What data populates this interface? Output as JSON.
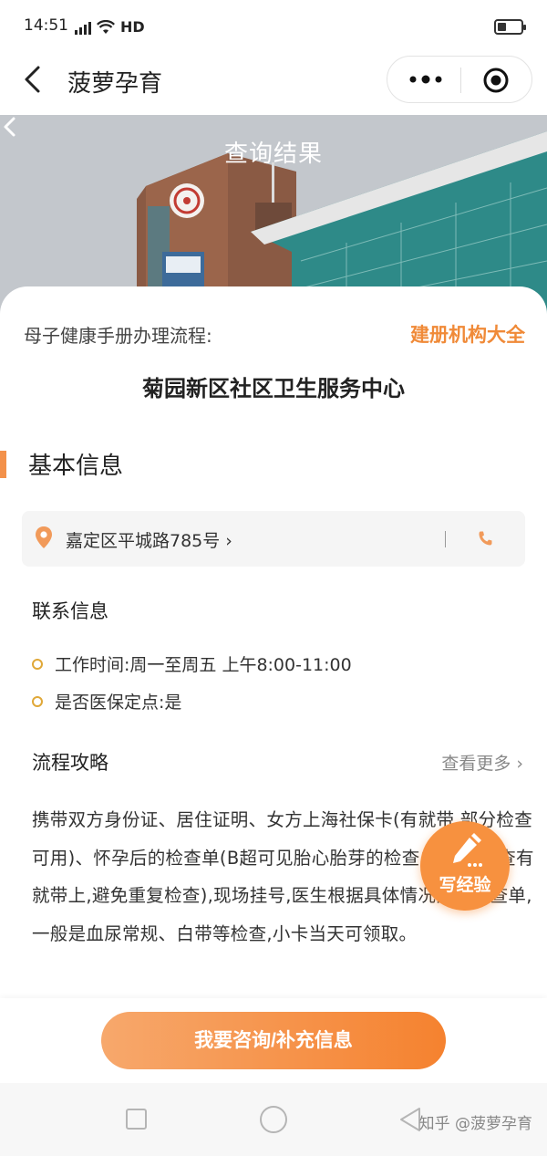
{
  "status_bar": {
    "time": "14:51",
    "network": "4G",
    "hd": "HD"
  },
  "nav": {
    "title": "菠萝孕育",
    "back_icon": "chevron-left-icon",
    "more_icon": "more-dots-icon",
    "close_icon": "target-circle-icon"
  },
  "banner": {
    "title": "查询结果"
  },
  "card": {
    "flow_label": "母子健康手册办理流程:",
    "org_link": "建册机构大全",
    "center_name": "菊园新区社区卫生服务中心",
    "basic_info_title": "基本信息",
    "address": "嘉定区平城路785号 ›",
    "contact_title": "联系信息",
    "work_time": "工作时间:周一至周五 上午8:00-11:00",
    "insurance": "是否医保定点:是",
    "flow_title": "流程攻略",
    "see_more": "查看更多 ›",
    "flow_text": "携带双方身份证、居住证明、女方上海社保卡(有就带,部分检查可用)、怀孕后的检查单(B超可见胎心胎芽的检查单,其他检查有就带上,避免重复检查),现场挂号,医生根据具体情况开具检查单,一般是血尿常规、白带等检查,小卡当天可领取。"
  },
  "fab": {
    "label": "写经验",
    "icon": "pencil-icon"
  },
  "bottom": {
    "consult_label": "我要咨询/补充信息"
  },
  "watermark": "知乎 @菠萝孕育",
  "colors": {
    "accent": "#f08a38",
    "section_bar": "#f3914a",
    "dot": "#e0a838",
    "button_start": "#f7a86c",
    "button_end": "#f5822f"
  }
}
